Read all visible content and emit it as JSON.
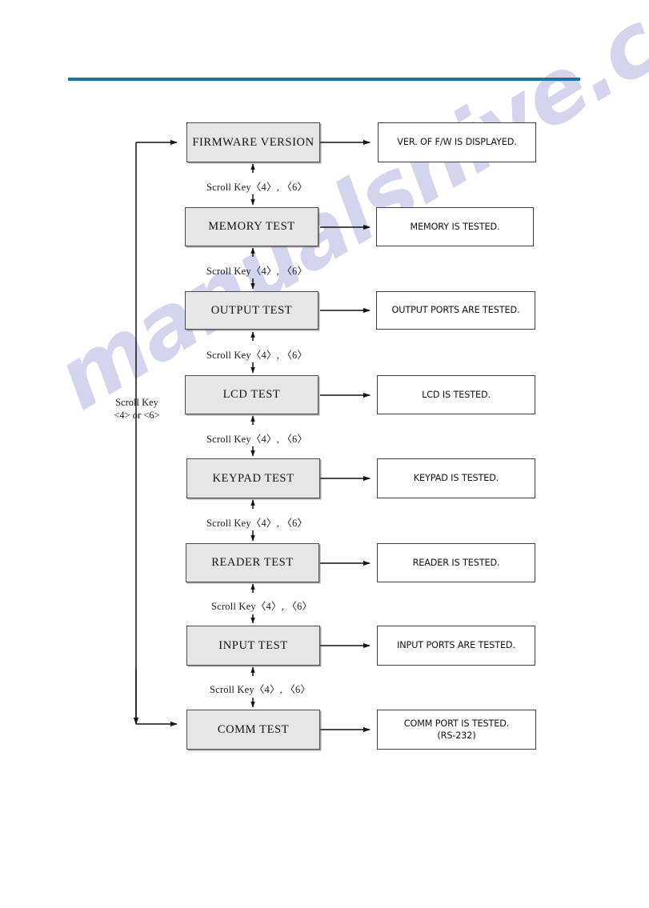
{
  "page": {
    "watermark": "manualshive.com",
    "rule_color": "#1472ac",
    "state_box_fill": "#e6e6e6",
    "desc_box_fill": "#ffffff"
  },
  "diagram": {
    "loop_label_line1": "Scroll Key",
    "loop_label_line2": "<4> or <6>",
    "transition_label": "Scroll Key〈4〉, 〈6〉",
    "steps": [
      {
        "state": "FIRMWARE VERSION",
        "description": "VER. OF F/W IS DISPLAYED.",
        "description2": ""
      },
      {
        "state": "MEMORY TEST",
        "description": "MEMORY IS TESTED.",
        "description2": ""
      },
      {
        "state": "OUTPUT TEST",
        "description": "OUTPUT PORTS ARE TESTED.",
        "description2": ""
      },
      {
        "state": "LCD TEST",
        "description": "LCD IS TESTED.",
        "description2": ""
      },
      {
        "state": "KEYPAD TEST",
        "description": "KEYPAD IS TESTED.",
        "description2": ""
      },
      {
        "state": "READER TEST",
        "description": "READER IS TESTED.",
        "description2": ""
      },
      {
        "state": "INPUT TEST",
        "description": "INPUT PORTS ARE TESTED.",
        "description2": ""
      },
      {
        "state": "COMM TEST",
        "description": "COMM PORT IS TESTED.",
        "description2": "(RS-232)"
      }
    ],
    "transitions": [
      "Scroll Key〈4〉, 〈6〉",
      "Scroll Key〈4〉, 〈6〉",
      "Scroll Key〈4〉, 〈6〉",
      "Scroll Key〈4〉, 〈6〉",
      "Scroll Key〈4〉, 〈6〉",
      "Scroll Key〈4〉, 〈6〉",
      "Scroll Key〈4〉, 〈6〉"
    ]
  }
}
